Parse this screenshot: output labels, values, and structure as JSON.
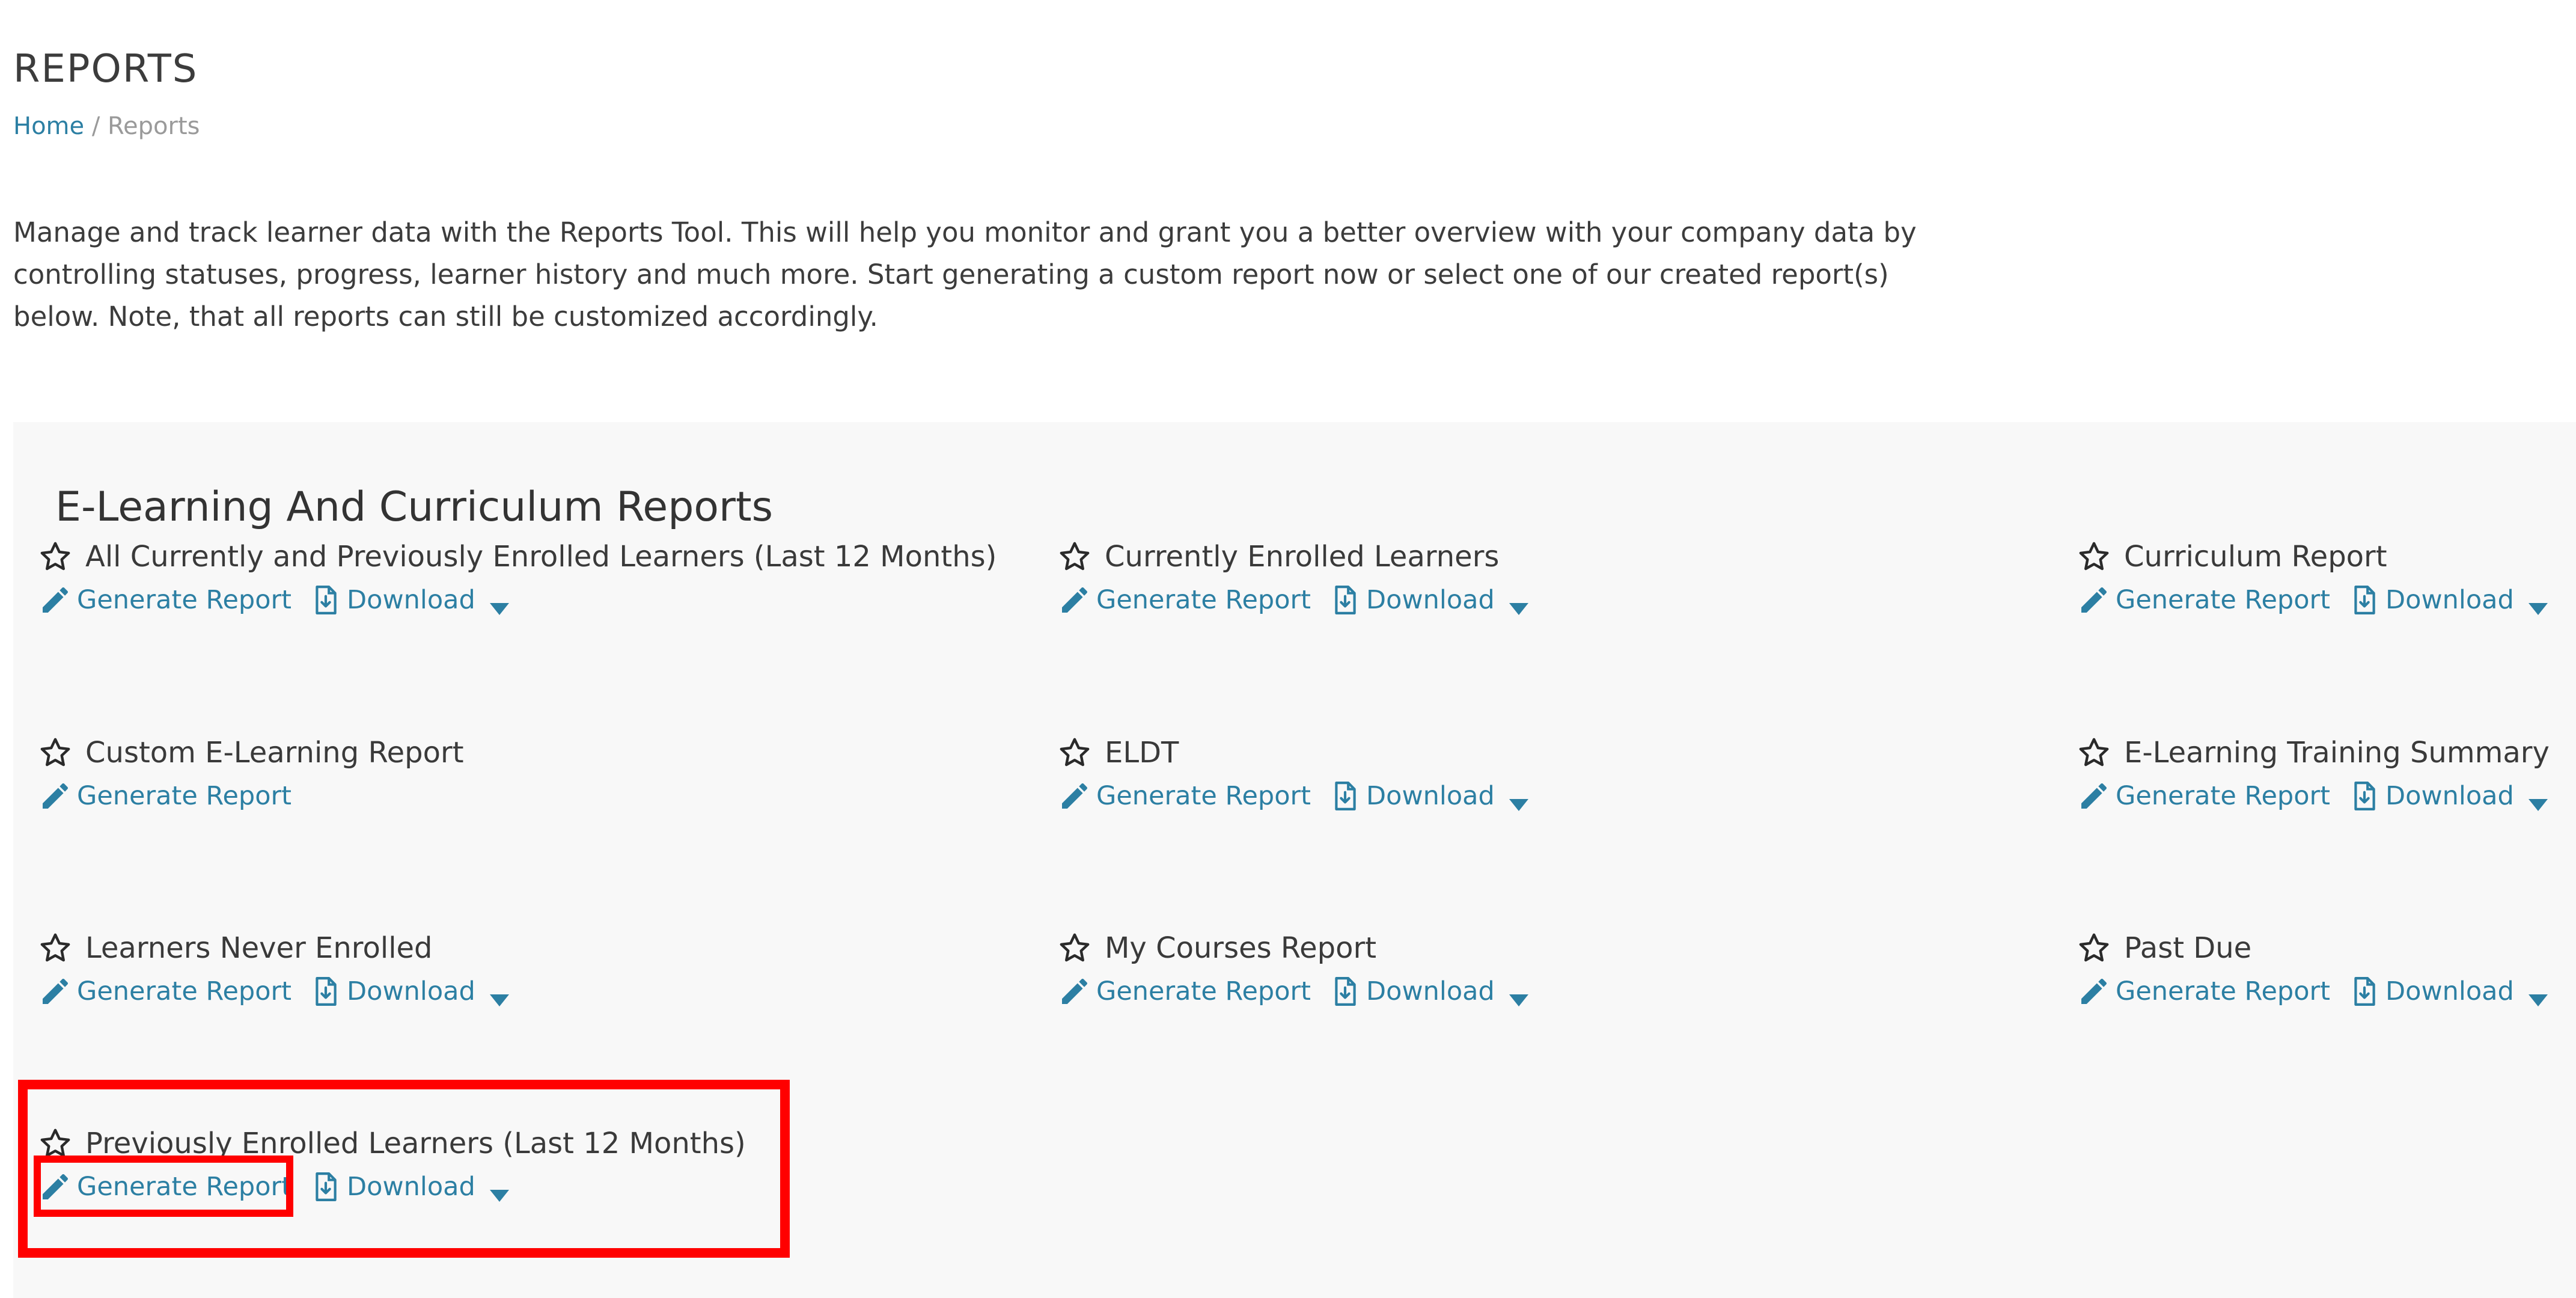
{
  "page": {
    "title": "REPORTS",
    "breadcrumb": {
      "home": "Home",
      "separator": "/",
      "current": "Reports"
    },
    "intro": "Manage and track learner data with the Reports Tool. This will help you monitor and grant you a better overview with your company data by controlling statuses, progress, learner history and much more. Start generating a custom report now or select one of our created report(s) below. Note, that all reports can still be customized accordingly."
  },
  "section": {
    "title": "E-Learning And Curriculum Reports",
    "generate_label": "Generate Report",
    "download_label": "Download",
    "reports": [
      {
        "name": "All Currently and Previously Enrolled Learners (Last 12 Months)",
        "has_download": true
      },
      {
        "name": "Currently Enrolled Learners",
        "has_download": true
      },
      {
        "name": "Curriculum Report",
        "has_download": true
      },
      {
        "name": "Custom E-Learning Report",
        "has_download": false
      },
      {
        "name": "ELDT",
        "has_download": true
      },
      {
        "name": "E-Learning Training Summary",
        "has_download": true
      },
      {
        "name": "Learners Never Enrolled",
        "has_download": true
      },
      {
        "name": "My Courses Report",
        "has_download": true
      },
      {
        "name": "Past Due",
        "has_download": true
      },
      {
        "name": "Previously Enrolled Learners (Last 12 Months)",
        "has_download": true
      }
    ]
  },
  "icons": {
    "favorite": "star-outline-icon",
    "generate": "pencil-icon",
    "download": "file-download-icon",
    "dropdown": "caret-down-icon"
  },
  "colors": {
    "link": "#2c7fa3",
    "highlight": "#ff0000",
    "panel_bg": "#f8f8f8"
  }
}
